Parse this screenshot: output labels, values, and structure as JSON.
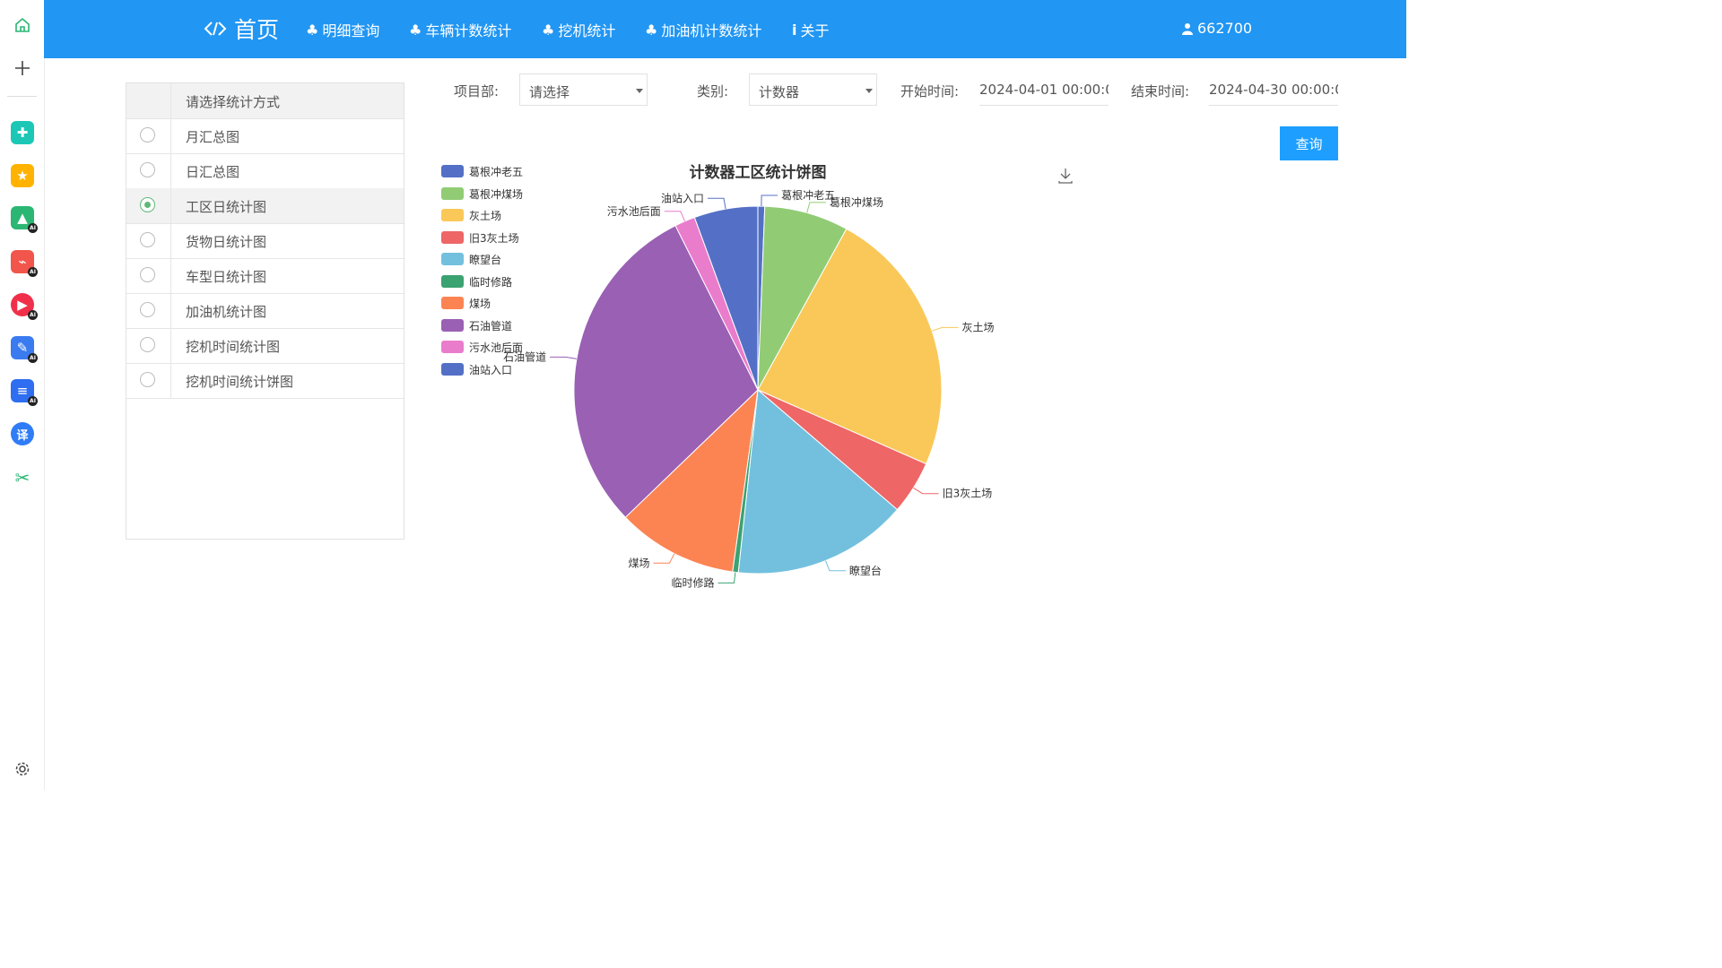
{
  "sidebar": {
    "icons": [
      "home-icon",
      "plus-icon",
      "clover-icon",
      "star-icon",
      "image-ai-icon",
      "pdf-ai-icon",
      "video-ai-icon",
      "pen-ai-icon",
      "doc-ai-icon",
      "translate-icon",
      "scissors-icon",
      "settings-icon"
    ],
    "ai_badge": "AI",
    "translate_glyph": "译"
  },
  "nav": {
    "home": "首页",
    "items": [
      "明细查询",
      "车辆计数统计",
      "挖机统计",
      "加油机计数统计",
      "关于"
    ],
    "user": "662700"
  },
  "menu": {
    "header": "请选择统计方式",
    "options": [
      "月汇总图",
      "日汇总图",
      "工区日统计图",
      "货物日统计图",
      "车型日统计图",
      "加油机统计图",
      "挖机时间统计图",
      "挖机时间统计饼图"
    ],
    "selected_index": 2
  },
  "filters": {
    "project_label": "项目部:",
    "project_value": "请选择",
    "category_label": "类别:",
    "category_value": "计数器",
    "start_label": "开始时间:",
    "start_value": "2024-04-01 00:00:0",
    "end_label": "结束时间:",
    "end_value": "2024-04-30 00:00:0",
    "query_button": "查询"
  },
  "colors": {
    "primary": "#2196f3",
    "button": "#1e9fff",
    "radio_on": "#5fb878"
  },
  "chart_data": {
    "type": "pie",
    "title": "计数器工区统计饼图",
    "legend_position": "top-left",
    "start_angle_deg": 90,
    "slices": [
      {
        "name": "葛根冲老五",
        "value": 0.6,
        "color": "#5470c6"
      },
      {
        "name": "葛根冲煤场",
        "value": 7.4,
        "color": "#91cc75"
      },
      {
        "name": "灰土场",
        "value": 23.6,
        "color": "#fac858"
      },
      {
        "name": "旧3灰土场",
        "value": 4.7,
        "color": "#ee6666"
      },
      {
        "name": "瞭望台",
        "value": 15.4,
        "color": "#73c0de"
      },
      {
        "name": "临时修路",
        "value": 0.5,
        "color": "#3ba272"
      },
      {
        "name": "煤场",
        "value": 10.6,
        "color": "#fc8452"
      },
      {
        "name": "石油管道",
        "value": 29.8,
        "color": "#9a60b4"
      },
      {
        "name": "污水池后面",
        "value": 1.8,
        "color": "#ea7ccc"
      },
      {
        "name": "油站入口",
        "value": 5.6,
        "color": "#5470c6"
      }
    ]
  }
}
